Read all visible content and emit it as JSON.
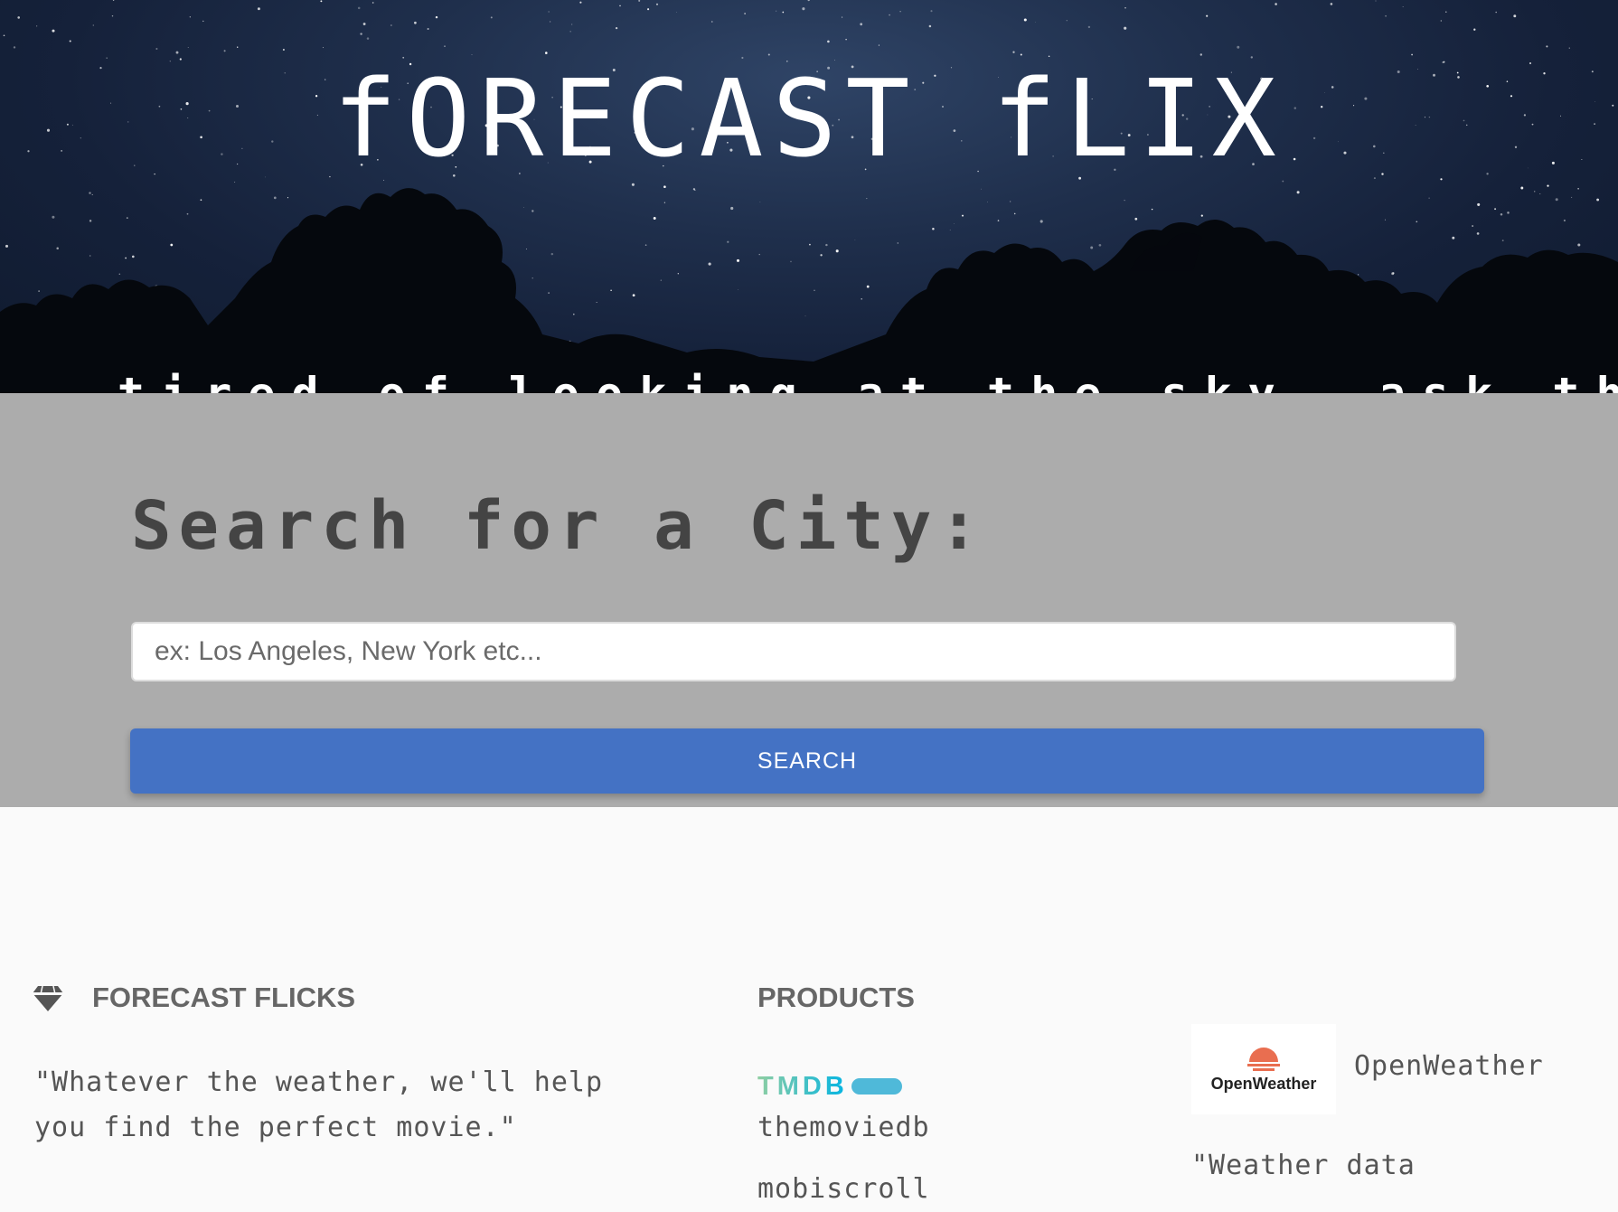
{
  "hero": {
    "title": "fORECAST fLIX",
    "tagline": "tired of looking at the sky, ask the weather what to binge!"
  },
  "search": {
    "heading": "Search for a City:",
    "placeholder": "ex: Los Angeles, New York etc...",
    "value": "",
    "button_label": "SEARCH",
    "button_color": "#4472c4"
  },
  "footer": {
    "brand": {
      "icon": "gem-icon",
      "title": "FORECAST FLICKS",
      "quote": "\"Whatever the weather, we'll help you find the perfect movie.\""
    },
    "products": {
      "title": "PRODUCTS",
      "tmdb_logo_text": "TMDB",
      "tmdb_name": "themoviedb",
      "next_item": "mobiscroll"
    },
    "weather": {
      "logo_text": "OpenWeather",
      "name": "OpenWeather",
      "quote": "\"Weather data"
    }
  }
}
